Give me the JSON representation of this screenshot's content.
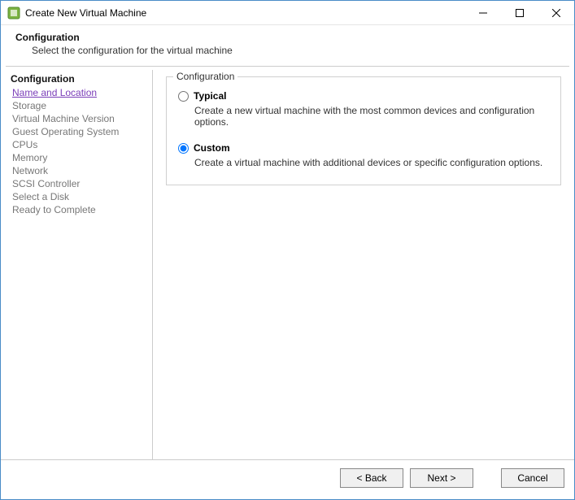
{
  "titlebar": {
    "title": "Create New Virtual Machine"
  },
  "header": {
    "title": "Configuration",
    "subtitle": "Select the configuration for the virtual machine"
  },
  "sidebar": {
    "heading": "Configuration",
    "active_link": "Name and Location",
    "items": [
      "Storage",
      "Virtual Machine Version",
      "Guest Operating System",
      "CPUs",
      "Memory",
      "Network",
      "SCSI Controller",
      "Select a Disk",
      "Ready to Complete"
    ]
  },
  "group": {
    "legend": "Configuration",
    "options": {
      "typical": {
        "label": "Typical",
        "desc": "Create a new virtual machine with the most common devices and configuration options.",
        "selected": false
      },
      "custom": {
        "label": "Custom",
        "desc": "Create a virtual machine with additional devices or specific configuration options.",
        "selected": true
      }
    }
  },
  "footer": {
    "back": "< Back",
    "next": "Next >",
    "cancel": "Cancel"
  }
}
